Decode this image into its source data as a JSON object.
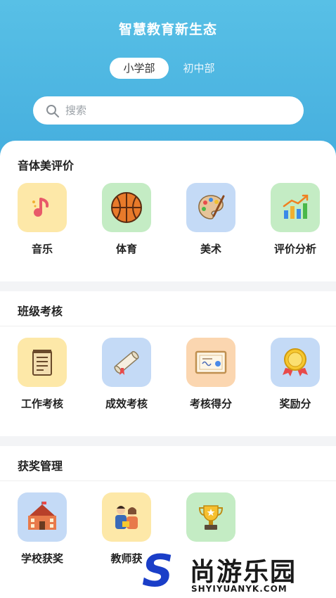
{
  "header": {
    "title": "智慧教育新生态",
    "tabs": [
      {
        "label": "小学部",
        "active": true
      },
      {
        "label": "初中部",
        "active": false
      }
    ],
    "search_placeholder": "搜索"
  },
  "colors": {
    "header_top": "#58c0e6",
    "header_bottom": "#45aede",
    "tile_yellow": "#fde8a8",
    "tile_green": "#c4ecc4",
    "tile_blue": "#c4daf6",
    "tile_orange": "#fbd6b0"
  },
  "sections": [
    {
      "title": "音体美评价",
      "items": [
        {
          "label": "音乐",
          "icon": "music-note-icon"
        },
        {
          "label": "体育",
          "icon": "basketball-icon"
        },
        {
          "label": "美术",
          "icon": "palette-icon"
        },
        {
          "label": "评价分析",
          "icon": "bar-chart-icon"
        }
      ]
    },
    {
      "title": "班级考核",
      "items": [
        {
          "label": "工作考核",
          "icon": "notepad-icon"
        },
        {
          "label": "成效考核",
          "icon": "scroll-icon"
        },
        {
          "label": "考核得分",
          "icon": "certificate-icon"
        },
        {
          "label": "奖励分",
          "icon": "medal-icon"
        }
      ]
    },
    {
      "title": "获奖管理",
      "items": [
        {
          "label": "学校获奖",
          "icon": "school-building-icon"
        },
        {
          "label": "教师获",
          "icon": "teachers-icon"
        },
        {
          "label": "",
          "icon": "trophy-icon"
        }
      ]
    }
  ],
  "watermark": {
    "logo_letter": "S",
    "text": "尚游乐园",
    "url": "SHYIYUANYK.COM"
  }
}
